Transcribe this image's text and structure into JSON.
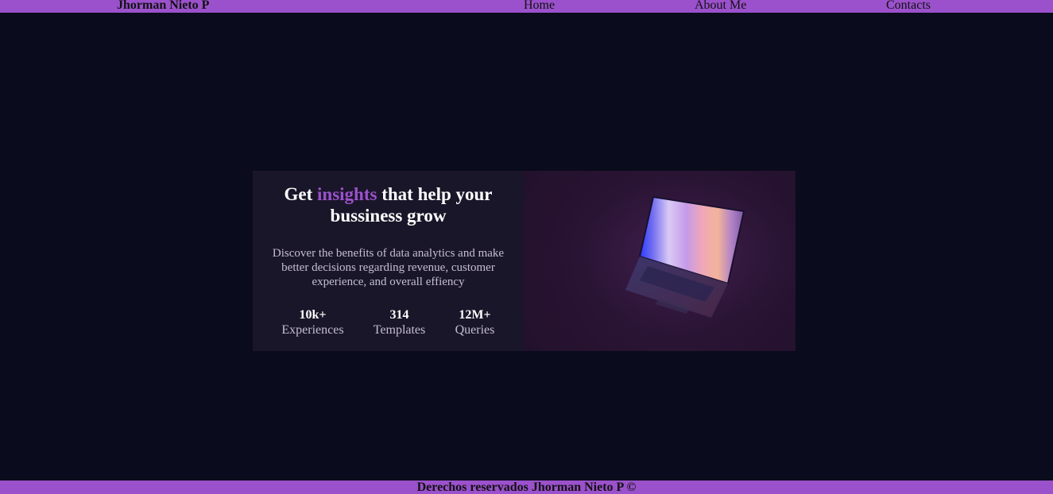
{
  "header": {
    "brand": "Jhorman Nieto P",
    "nav": {
      "home": "Home",
      "about": "About Me",
      "contacts": "Contacts"
    },
    "background_color": "#9b51cc"
  },
  "hero": {
    "headline_before": "Get ",
    "headline_accent": "insights",
    "headline_after": " that help your bussiness grow",
    "accent_color": "#9b51cc",
    "description": "Discover the benefits of data analytics and make better decisions regarding revenue, customer experience, and overall effiency",
    "stats": [
      {
        "value": "10k+",
        "label": "Experiences"
      },
      {
        "value": "314",
        "label": "Templates"
      },
      {
        "value": "12M+",
        "label": "Queries"
      }
    ],
    "image_icon": "laptop-image"
  },
  "footer": {
    "text": "Derechos reservados Jhorman Nieto P ©"
  },
  "colors": {
    "page_background": "#0a0b1c",
    "card_background": "#1a1629",
    "image_tint": "#2a1434"
  }
}
